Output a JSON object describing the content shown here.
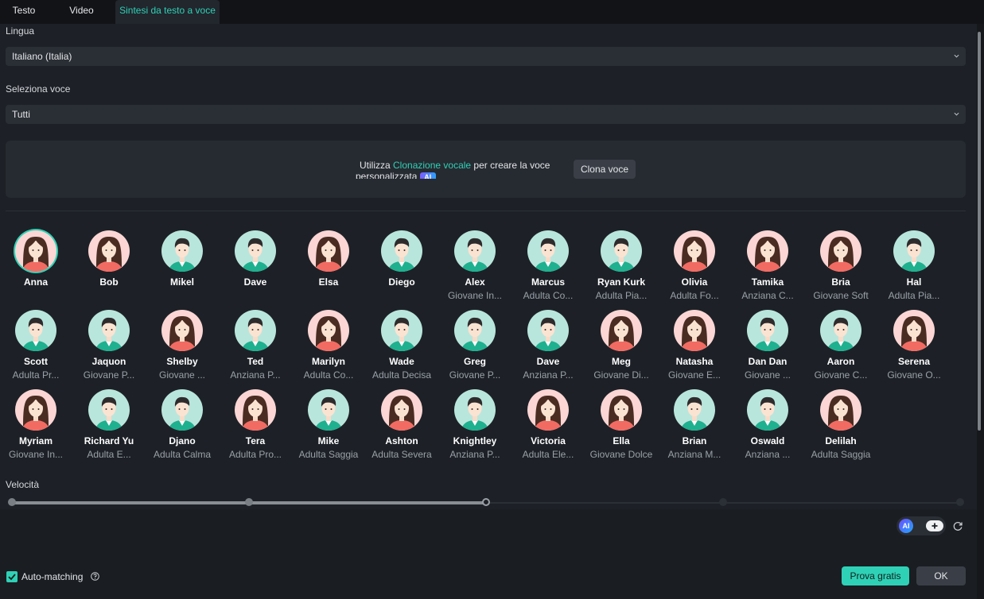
{
  "tabs": [
    {
      "label": "Testo",
      "active": false
    },
    {
      "label": "Video",
      "active": false
    },
    {
      "label": "Sintesi da testo a voce",
      "active": true
    }
  ],
  "language": {
    "label": "Lingua",
    "value": "Italiano (Italia)"
  },
  "voice_select": {
    "label": "Seleziona voce",
    "value": "Tutti"
  },
  "clone": {
    "text_pre": "Utilizza ",
    "link": "Clonazione vocale",
    "text_post": " per creare la voce personalizzata",
    "badge": "AI",
    "button": "Clona voce"
  },
  "voices": [
    {
      "name": "Anna",
      "desc": "",
      "gender": "f",
      "selected": true
    },
    {
      "name": "Bob",
      "desc": "",
      "gender": "f"
    },
    {
      "name": "Mikel",
      "desc": "",
      "gender": "m"
    },
    {
      "name": "Dave",
      "desc": "",
      "gender": "m"
    },
    {
      "name": "Elsa",
      "desc": "",
      "gender": "f"
    },
    {
      "name": "Diego",
      "desc": "",
      "gender": "m"
    },
    {
      "name": "Alex",
      "desc": "Giovane In...",
      "gender": "m"
    },
    {
      "name": "Marcus",
      "desc": "Adulta Co...",
      "gender": "m"
    },
    {
      "name": "Ryan Kurk",
      "desc": "Adulta Pia...",
      "gender": "m"
    },
    {
      "name": "Olivia",
      "desc": "Adulta Fo...",
      "gender": "f"
    },
    {
      "name": "Tamika",
      "desc": "Anziana C...",
      "gender": "f"
    },
    {
      "name": "Bria",
      "desc": "Giovane Soft",
      "gender": "f"
    },
    {
      "name": "Hal",
      "desc": "Adulta Pia...",
      "gender": "m"
    },
    {
      "name": "Scott",
      "desc": "Adulta Pr...",
      "gender": "m"
    },
    {
      "name": "Jaquon",
      "desc": "Giovane P...",
      "gender": "m"
    },
    {
      "name": "Shelby",
      "desc": "Giovane ...",
      "gender": "f"
    },
    {
      "name": "Ted",
      "desc": "Anziana P...",
      "gender": "m"
    },
    {
      "name": "Marilyn",
      "desc": "Adulta Co...",
      "gender": "f"
    },
    {
      "name": "Wade",
      "desc": "Adulta Decisa",
      "gender": "m"
    },
    {
      "name": "Greg",
      "desc": "Giovane P...",
      "gender": "m"
    },
    {
      "name": "Dave",
      "desc": "Anziana P...",
      "gender": "m"
    },
    {
      "name": "Meg",
      "desc": "Giovane Di...",
      "gender": "f"
    },
    {
      "name": "Natasha",
      "desc": "Giovane E...",
      "gender": "f"
    },
    {
      "name": "Dan Dan",
      "desc": "Giovane ...",
      "gender": "m"
    },
    {
      "name": "Aaron",
      "desc": "Giovane C...",
      "gender": "m"
    },
    {
      "name": "Serena",
      "desc": "Giovane O...",
      "gender": "f"
    },
    {
      "name": "Myriam",
      "desc": "Giovane In...",
      "gender": "f"
    },
    {
      "name": "Richard Yu",
      "desc": "Adulta E...",
      "gender": "m"
    },
    {
      "name": "Djano",
      "desc": "Adulta Calma",
      "gender": "m"
    },
    {
      "name": "Tera",
      "desc": "Adulta Pro...",
      "gender": "f"
    },
    {
      "name": "Mike",
      "desc": "Adulta Saggia",
      "gender": "m"
    },
    {
      "name": "Ashton",
      "desc": "Adulta Severa",
      "gender": "f"
    },
    {
      "name": "Knightley",
      "desc": "Anziana P...",
      "gender": "m"
    },
    {
      "name": "Victoria",
      "desc": "Adulta Ele...",
      "gender": "f"
    },
    {
      "name": "Ella",
      "desc": "Giovane Dolce",
      "gender": "f"
    },
    {
      "name": "Brian",
      "desc": "Anziana M...",
      "gender": "m"
    },
    {
      "name": "Oswald",
      "desc": "Anziana ...",
      "gender": "m"
    },
    {
      "name": "Delilah",
      "desc": "Adulta Saggia",
      "gender": "f"
    }
  ],
  "speed": {
    "label": "Velocità",
    "value": 0.5,
    "steps": 5
  },
  "ai_badge": "AI",
  "auto_matching": {
    "label": "Auto-matching",
    "checked": true
  },
  "buttons": {
    "try": "Prova gratis",
    "ok": "OK"
  },
  "colors": {
    "accent": "#2fd1b6",
    "background": "#1d2127",
    "female_avatar": "#fbd6d4",
    "male_avatar": "#b9e6dc"
  }
}
